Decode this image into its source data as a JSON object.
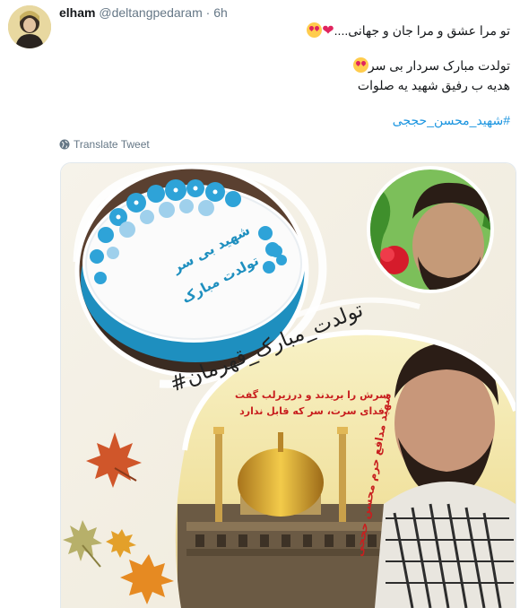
{
  "tweet": {
    "display_name": "elham",
    "handle": "@deltangpedaram",
    "separator": "·",
    "time": "6h",
    "line1": "تو مرا عشق و مرا جان و جهانی....",
    "line2": "تولدت مبارک سردار بی سر",
    "line3": "هدیه ب رفیق شهید یه صلوات",
    "hashtag": "#شهید_محسن_حججی",
    "translate_label": "Translate Tweet"
  },
  "media": {
    "cake_text_1": "شهید بی سر",
    "cake_text_2": "تولدت مبارک",
    "banner": "#تولدت_مبارک_قهرمان",
    "quote_1": "سرش را بریدند و درزیرلب گفت",
    "quote_2": "فدای سرت، سر که قابل ندارد",
    "name_overlay": "شهید مدافع حرم محسن حججی"
  },
  "colors": {
    "link": "#1b95e0",
    "secondary": "#657786",
    "border": "#e1e8ed",
    "heart": "#e0245e",
    "emoji": "#ffcc4d"
  }
}
